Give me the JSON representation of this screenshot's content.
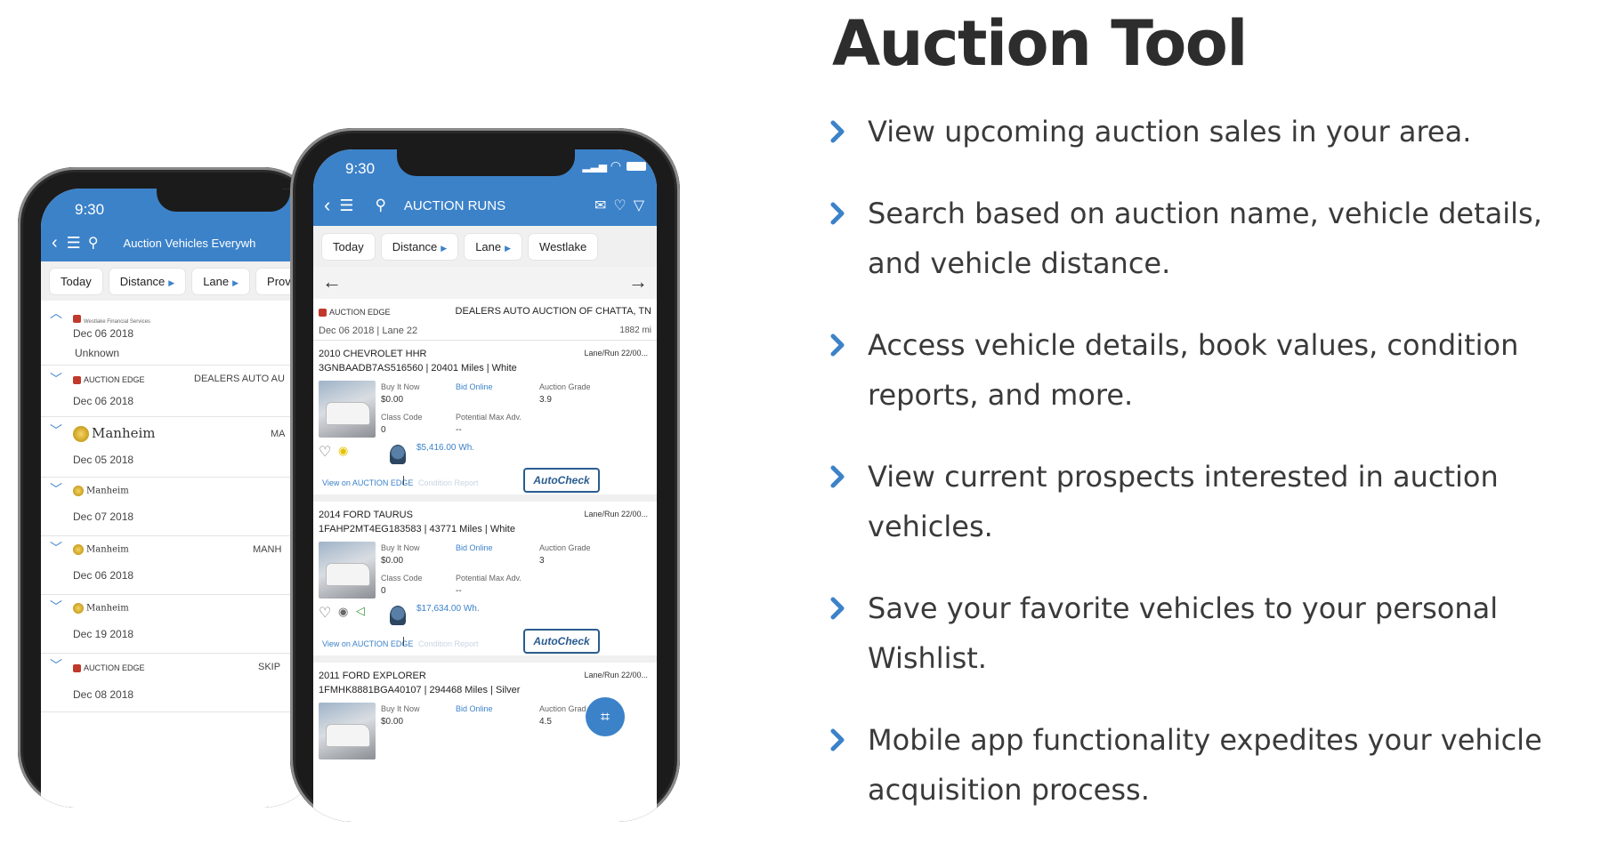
{
  "heading": "Auction Tool",
  "features": [
    "View upcoming auction sales in your area.",
    "Search based on auction name, vehicle details, and vehicle distance.",
    "Access vehicle details, book values, condition reports, and more.",
    "View current prospects interested in auction vehicles.",
    "Save your favorite vehicles to your personal Wishlist.",
    "Mobile app functionality expedites your vehicle acquisition process."
  ],
  "colors": {
    "accent": "#3c82c9",
    "heading": "#2d2d2d",
    "bullet": "#3c82c9"
  },
  "back_phone": {
    "time": "9:30",
    "title": "Auction Vehicles Everywh",
    "chips": [
      "Today",
      "Distance",
      "Lane",
      "Prov"
    ],
    "rows": [
      {
        "logo": "Westlake",
        "detail": "Westlake Financial Services",
        "date": "Dec 06 2018",
        "extra": "Unknown",
        "right": ""
      },
      {
        "logo": "AUCTION EDGE",
        "detail": "",
        "date": "Dec 06 2018",
        "extra": "",
        "right": "DEALERS AUTO AU"
      },
      {
        "logo": "Manheim",
        "detail": "",
        "date": "Dec 05 2018",
        "extra": "",
        "right": "MA"
      },
      {
        "logo": "Manheim",
        "detail": "",
        "date": "Dec 07 2018",
        "extra": "",
        "right": ""
      },
      {
        "logo": "Manheim",
        "detail": "",
        "date": "Dec 06 2018",
        "extra": "",
        "right": "MANH"
      },
      {
        "logo": "Manheim",
        "detail": "",
        "date": "Dec 19 2018",
        "extra": "",
        "right": ""
      },
      {
        "logo": "AUCTION EDGE",
        "detail": "",
        "date": "Dec 08 2018",
        "extra": "",
        "right": "SKIP"
      }
    ]
  },
  "front_phone": {
    "time": "9:30",
    "title": "AUCTION RUNS",
    "chips": [
      "Today",
      "Distance",
      "Lane",
      "Westlake"
    ],
    "auction": {
      "logo": "AUCTION EDGE",
      "name": "DEALERS AUTO AUCTION OF CHATTA, TN",
      "date": "Dec 06 2018 | Lane 22",
      "distance": "1882 mi"
    },
    "listings": [
      {
        "title": "2010 CHEVROLET HHR",
        "vin": "3GNBAADB7AS516560 | 20401 Miles | White",
        "lane": "Lane/Run 22/00...",
        "buy_label": "Buy It Now",
        "buy_value": "$0.00",
        "bid": "Bid Online",
        "grade_label": "Auction Grade",
        "grade": "3.9",
        "class_label": "Class Code",
        "class_value": "0",
        "pma_label": "Potential Max Adv.",
        "pma_value": "--",
        "price": "$5,416.00 Wh.",
        "view": "View on AUCTION EDGE",
        "cr": "Condition Report",
        "autocheck": "AutoCheck"
      },
      {
        "title": "2014 FORD TAURUS",
        "vin": "1FAHP2MT4EG183583 | 43771 Miles | White",
        "lane": "Lane/Run 22/00...",
        "buy_label": "Buy It Now",
        "buy_value": "$0.00",
        "bid": "Bid Online",
        "grade_label": "Auction Grade",
        "grade": "3",
        "class_label": "Class Code",
        "class_value": "0",
        "pma_label": "Potential Max Adv.",
        "pma_value": "--",
        "price": "$17,634.00 Wh.",
        "view": "View on AUCTION EDGE",
        "cr": "Condition Report",
        "autocheck": "AutoCheck"
      },
      {
        "title": "2011 FORD EXPLORER",
        "vin": "1FMHK8881BGA40107 | 294468 Miles | Silver",
        "lane": "Lane/Run 22/00...",
        "buy_label": "Buy It Now",
        "buy_value": "$0.00",
        "bid": "Bid Online",
        "grade_label": "Auction Grad",
        "grade": "4.5"
      }
    ]
  }
}
